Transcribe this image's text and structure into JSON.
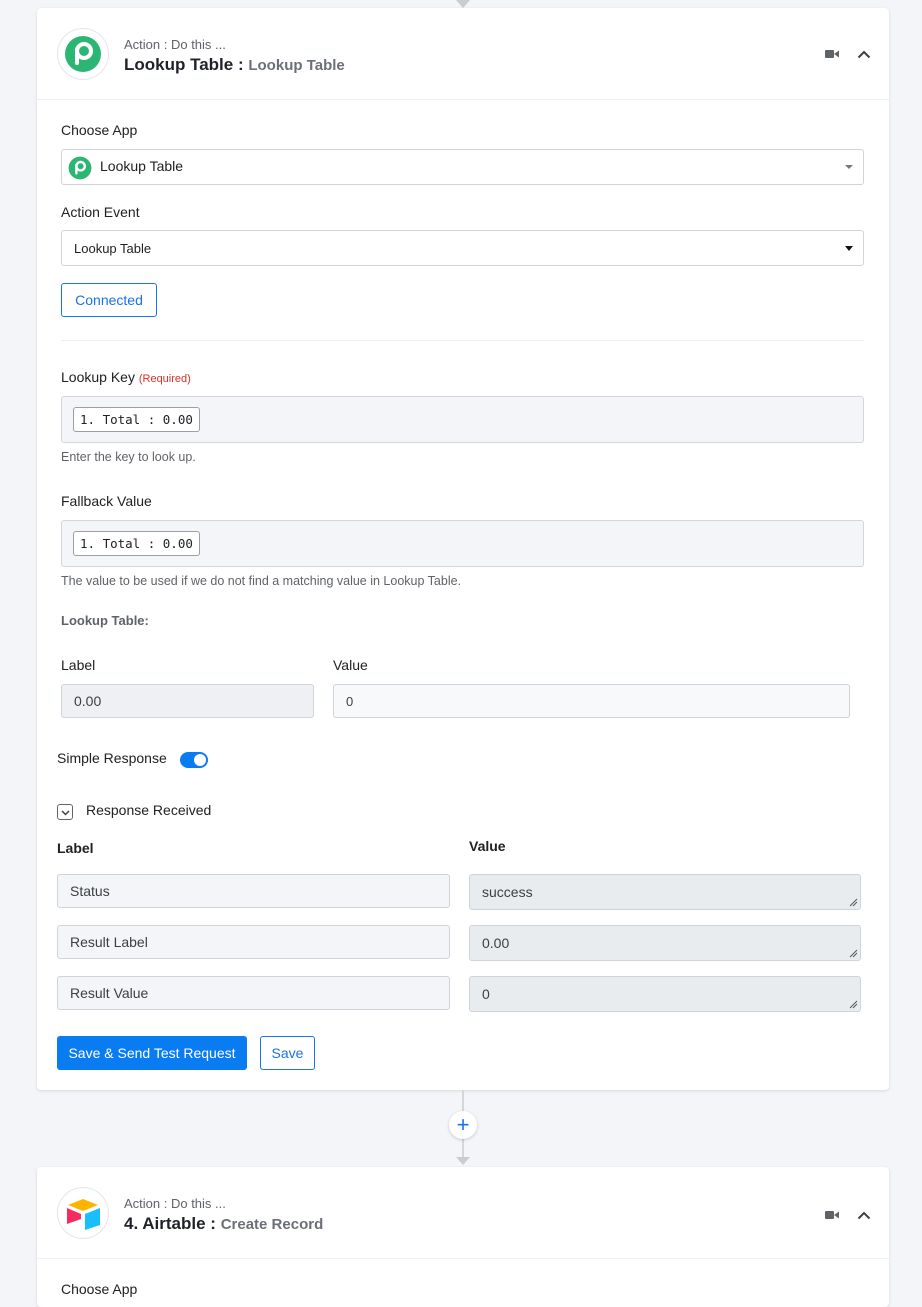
{
  "step3": {
    "header": {
      "subtitle": "Action : Do this ...",
      "title_app": "Lookup Table :",
      "title_event": "Lookup Table"
    },
    "choose_app": {
      "label": "Choose App",
      "value": "Lookup Table"
    },
    "action_event": {
      "label": "Action Event",
      "value": "Lookup Table"
    },
    "connected_label": "Connected",
    "lookup_key": {
      "label": "Lookup Key",
      "required": "(Required)",
      "token": "1. Total : 0.00",
      "helper": "Enter the key to look up."
    },
    "fallback_value": {
      "label": "Fallback Value",
      "token": "1. Total : 0.00",
      "helper": "The value to be used if we do not find a matching value in Lookup Table."
    },
    "lookup_table": {
      "heading": "Lookup Table:",
      "label_col": "Label",
      "value_col": "Value",
      "rows": [
        {
          "label": "0.00",
          "value": "0"
        }
      ]
    },
    "simple_response": {
      "label": "Simple Response",
      "enabled": true
    },
    "response_received": {
      "label": "Response Received",
      "label_col": "Label",
      "value_col": "Value",
      "rows": [
        {
          "label": "Status",
          "value": "success"
        },
        {
          "label": "Result Label",
          "value": "0.00"
        },
        {
          "label": "Result Value",
          "value": "0"
        }
      ]
    },
    "buttons": {
      "save_send": "Save & Send Test Request",
      "save": "Save"
    }
  },
  "step4": {
    "header": {
      "subtitle": "Action : Do this ...",
      "title_app": "4. Airtable :",
      "title_event": "Create Record"
    },
    "choose_app": {
      "label": "Choose App"
    }
  },
  "icons": {
    "video": "video-camera-icon",
    "collapse": "chevron-up-icon",
    "add": "plus-icon"
  },
  "colors": {
    "accent": "#0a7cf2",
    "pabbly_green": "#2bb673",
    "page_bg": "#f3f5f8"
  }
}
